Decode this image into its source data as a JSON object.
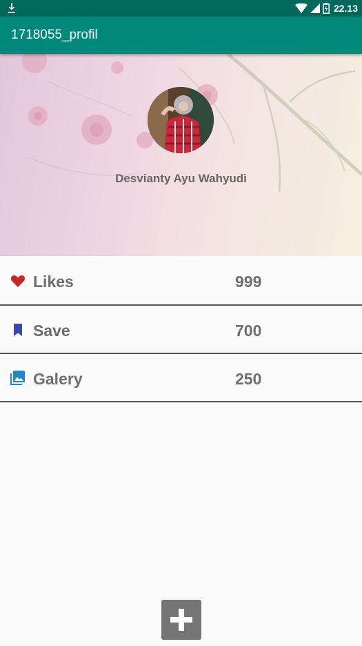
{
  "status_bar": {
    "time": "22.13"
  },
  "app_bar": {
    "title": "1718055_profil"
  },
  "profile": {
    "name": "Desvianty Ayu Wahyudi"
  },
  "stats": [
    {
      "icon": "heart-icon",
      "label": "Likes",
      "value": "999",
      "color": "#c62828"
    },
    {
      "icon": "bookmark-icon",
      "label": "Save",
      "value": "700",
      "color": "#3949ab"
    },
    {
      "icon": "gallery-icon",
      "label": "Galery",
      "value": "250",
      "color": "#1e88c8"
    }
  ],
  "fab": {
    "icon": "add-icon"
  }
}
